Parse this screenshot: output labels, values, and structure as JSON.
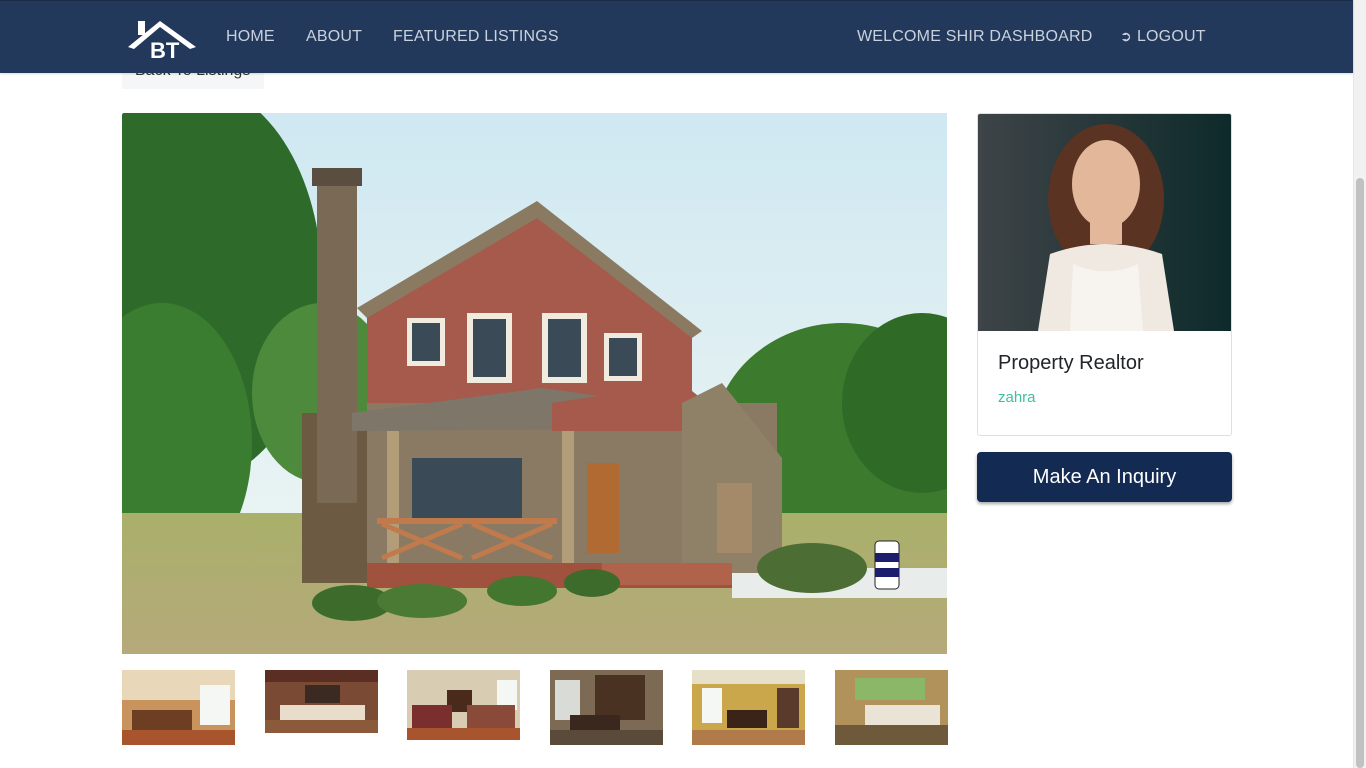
{
  "nav": {
    "logo_text": "BT",
    "items": [
      {
        "label": "HOME"
      },
      {
        "label": "ABOUT"
      },
      {
        "label": "FEATURED LISTINGS"
      }
    ],
    "welcome": "WELCOME SHIR DASHBOARD",
    "logout": "LOGOUT",
    "logout_icon": "sign-out-icon"
  },
  "back_button": "Back To Listings",
  "realtor": {
    "title": "Property Realtor",
    "name": "zahra"
  },
  "inquiry_button": "Make An Inquiry",
  "colors": {
    "navbar": "#23395c",
    "accent_link": "#3ec0a0",
    "inquiry_button": "#132a52"
  }
}
